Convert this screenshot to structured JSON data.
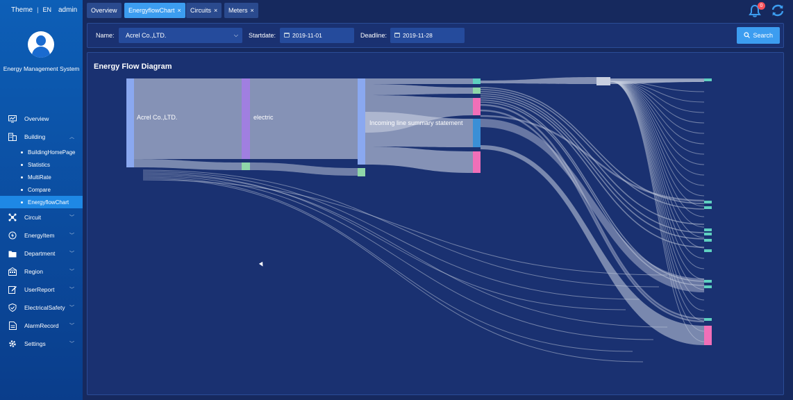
{
  "app": {
    "theme_label": "Theme",
    "lang_label": "EN",
    "user": "admin",
    "system_name": "Energy Management System"
  },
  "tabs": [
    {
      "label": "Overview",
      "closable": false,
      "active": false
    },
    {
      "label": "EnergyflowChart",
      "closable": true,
      "active": true
    },
    {
      "label": "Circuits",
      "closable": true,
      "active": false
    },
    {
      "label": "Meters",
      "closable": true,
      "active": false
    }
  ],
  "close_glyph": "×",
  "notifications": {
    "count": "0"
  },
  "menu": {
    "overview": "Overview",
    "building": "Building",
    "building_sub": [
      "BuildingHomePage",
      "Statistics",
      "MultiRate",
      "Compare",
      "EnergyflowChart"
    ],
    "circuit": "Circuit",
    "energyitem": "EnergyItem",
    "department": "Department",
    "region": "Region",
    "userreport": "UserReport",
    "electricalsafety": "ElectricalSafety",
    "alarmrecord": "AlarmRecord",
    "settings": "Settings"
  },
  "filter": {
    "name_label": "Name:",
    "name_value": "Acrel Co.,LTD.",
    "startdate_label": "Startdate:",
    "startdate_value": "2019-11-01",
    "deadline_label": "Deadline:",
    "deadline_value": "2019-11-28",
    "search_label": "Search"
  },
  "chart_title": "Energy Flow Diagram",
  "colors": {
    "accent": "#3c9df0",
    "node_blue": "#8aa8f0",
    "node_purple": "#a07fe0",
    "node_green": "#8fd6a8",
    "node_pink": "#f06fb8",
    "node_teal": "#5fd0c0",
    "link": "#c8cfe0"
  },
  "chart_data": {
    "type": "sankey",
    "node_labels": {
      "root": "Acrel Co.,LTD.",
      "electric": "electric",
      "incoming": "Incoming line summary statement"
    }
  }
}
